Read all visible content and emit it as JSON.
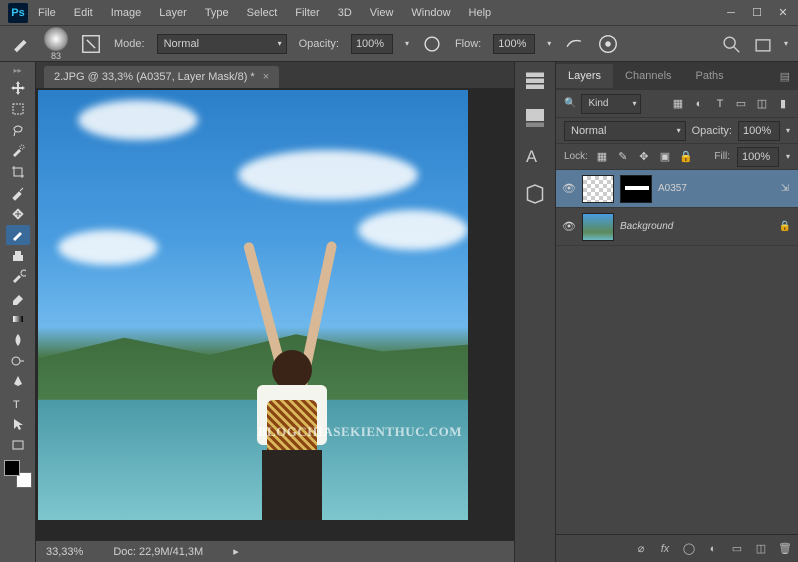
{
  "app": {
    "logo": "Ps"
  },
  "menu": {
    "items": [
      "File",
      "Edit",
      "Image",
      "Layer",
      "Type",
      "Select",
      "Filter",
      "3D",
      "View",
      "Window",
      "Help"
    ]
  },
  "options": {
    "brush_size": "83",
    "mode_label": "Mode:",
    "mode_value": "Normal",
    "opacity_label": "Opacity:",
    "opacity_value": "100%",
    "flow_label": "Flow:",
    "flow_value": "100%"
  },
  "document": {
    "tab_title": "2.JPG @ 33,3% (A0357, Layer Mask/8) *",
    "watermark": "BLOGCHIASEKIENTHUC.COM",
    "status_zoom": "33,33%",
    "status_doc_label": "Doc:",
    "status_doc_value": "22,9M/41,3M"
  },
  "panels": {
    "tabs": {
      "layers": "Layers",
      "channels": "Channels",
      "paths": "Paths"
    },
    "filter": {
      "kind": "Kind"
    },
    "blend": {
      "mode": "Normal",
      "opacity_label": "Opacity:",
      "opacity_value": "100%"
    },
    "lock": {
      "label": "Lock:",
      "fill_label": "Fill:",
      "fill_value": "100%"
    },
    "layers": [
      {
        "name": "A0357",
        "selected": true,
        "has_mask": true,
        "locked": false
      },
      {
        "name": "Background",
        "selected": false,
        "has_mask": false,
        "locked": true
      }
    ]
  }
}
